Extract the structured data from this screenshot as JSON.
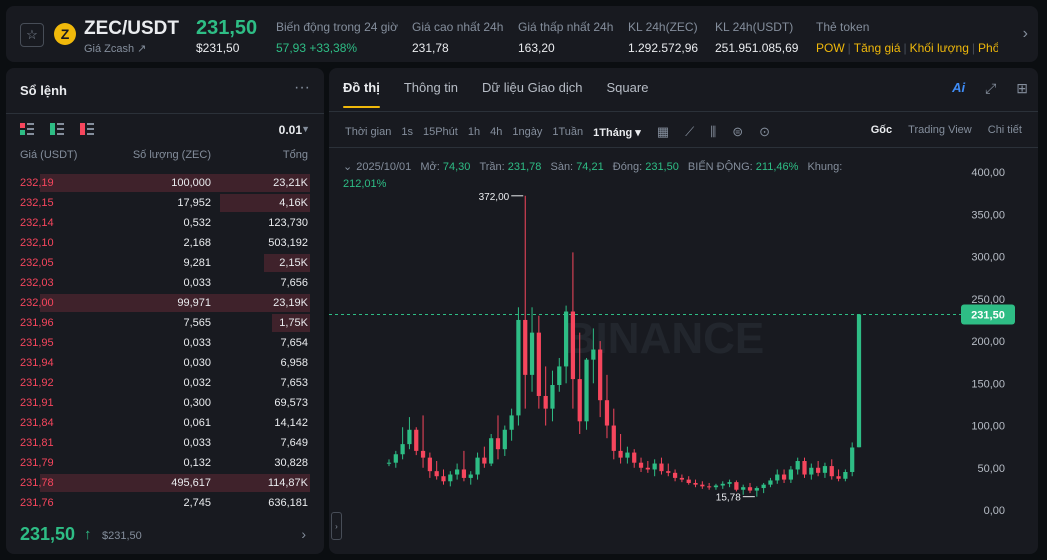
{
  "header": {
    "symbol": "ZEC/USDT",
    "coin_letter": "Z",
    "subtitle": "Giá Zcash ↗",
    "price": "231,50",
    "price_usd": "$231,50",
    "stats": [
      {
        "label": "Biến động trong 24 giờ",
        "value": "57,93 +33,38%",
        "positive": true
      },
      {
        "label": "Giá cao nhất 24h",
        "value": "231,78"
      },
      {
        "label": "Giá thấp nhất 24h",
        "value": "163,20"
      },
      {
        "label": "KL 24h(ZEC)",
        "value": "1.292.572,96"
      },
      {
        "label": "KL 24h(USDT)",
        "value": "251.951.085,69"
      }
    ],
    "token_label": "Thẻ token",
    "token_tags": [
      "POW",
      "Tăng giá",
      "Khối lượng",
      "Phổ"
    ]
  },
  "orderbook": {
    "title": "Sổ lệnh",
    "tick": "0.01",
    "col_price": "Giá (USDT)",
    "col_qty": "Số lượng (ZEC)",
    "col_total": "Tổng",
    "asks": [
      {
        "price": "232,19",
        "qty": "100,000",
        "total": "23,21K",
        "depth": 0.93
      },
      {
        "price": "232,15",
        "qty": "17,952",
        "total": "4,16K",
        "depth": 0.31
      },
      {
        "price": "232,14",
        "qty": "0,532",
        "total": "123,730",
        "depth": 0.0
      },
      {
        "price": "232,10",
        "qty": "2,168",
        "total": "503,192",
        "depth": 0.0
      },
      {
        "price": "232,05",
        "qty": "9,281",
        "total": "2,15K",
        "depth": 0.16
      },
      {
        "price": "232,03",
        "qty": "0,033",
        "total": "7,656",
        "depth": 0.0
      },
      {
        "price": "232,00",
        "qty": "99,971",
        "total": "23,19K",
        "depth": 0.93
      },
      {
        "price": "231,96",
        "qty": "7,565",
        "total": "1,75K",
        "depth": 0.13
      },
      {
        "price": "231,95",
        "qty": "0,033",
        "total": "7,654",
        "depth": 0.0
      },
      {
        "price": "231,94",
        "qty": "0,030",
        "total": "6,958",
        "depth": 0.0
      },
      {
        "price": "231,92",
        "qty": "0,032",
        "total": "7,653",
        "depth": 0.0
      },
      {
        "price": "231,91",
        "qty": "0,300",
        "total": "69,573",
        "depth": 0.0
      },
      {
        "price": "231,84",
        "qty": "0,061",
        "total": "14,142",
        "depth": 0.0
      },
      {
        "price": "231,81",
        "qty": "0,033",
        "total": "7,649",
        "depth": 0.0
      },
      {
        "price": "231,79",
        "qty": "0,132",
        "total": "30,828",
        "depth": 0.0
      },
      {
        "price": "231,78",
        "qty": "495,617",
        "total": "114,87K",
        "depth": 0.93
      },
      {
        "price": "231,76",
        "qty": "2,745",
        "total": "636,181",
        "depth": 0.0
      }
    ],
    "last_price": "231,50",
    "last_arrow": "↑",
    "last_usd": "$231,50"
  },
  "chart_panel": {
    "tabs": [
      "Đồ thị",
      "Thông tin",
      "Dữ liệu Giao dịch",
      "Square"
    ],
    "active_tab": "Đồ thị",
    "ai_label": "Ai",
    "timeframe_label": "Thời gian",
    "timeframes": [
      "1s",
      "15Phút",
      "1h",
      "4h",
      "1ngày",
      "1Tuần",
      "1Tháng ▾"
    ],
    "selected_timeframe": "1Tháng ▾",
    "views": [
      "Gốc",
      "Trading View",
      "Chi tiết"
    ],
    "selected_view": "Gốc",
    "ohlc": {
      "date": "2025/10/01",
      "open_label": "Mở:",
      "open": "74,30",
      "high_label": "Trần:",
      "high": "231,78",
      "low_label": "Sàn:",
      "low": "74,21",
      "close_label": "Đóng:",
      "close": "231,50",
      "change_label": "BIẾN ĐỘNG:",
      "change": "211,46%",
      "range_label": "Khung:",
      "range": "212,01%"
    },
    "watermark": "BINANCE",
    "current_price_label": "231,50",
    "colors": {
      "up": "#2ebd85",
      "down": "#f6465d",
      "accent": "#f0b90b"
    }
  },
  "chart_data": {
    "type": "candlestick",
    "ylim": [
      0,
      420
    ],
    "yticks": [
      0,
      50,
      100,
      150,
      200,
      250,
      300,
      350,
      400
    ],
    "ytick_labels": [
      "0,00",
      "50,00",
      "100,00",
      "150,00",
      "200,00",
      "250,00",
      "300,00",
      "350,00",
      "400,00"
    ],
    "current_price": 231.5,
    "annotations": [
      {
        "label": "372,00",
        "value": 372.0
      },
      {
        "label": "15,78",
        "value": 15.78
      }
    ],
    "candles": [
      [
        55,
        60,
        52,
        56
      ],
      [
        56,
        70,
        50,
        66
      ],
      [
        66,
        98,
        60,
        78
      ],
      [
        78,
        110,
        72,
        95
      ],
      [
        95,
        98,
        65,
        70
      ],
      [
        70,
        112,
        50,
        62
      ],
      [
        62,
        68,
        38,
        46
      ],
      [
        46,
        58,
        36,
        40
      ],
      [
        40,
        48,
        30,
        34
      ],
      [
        34,
        46,
        28,
        42
      ],
      [
        42,
        55,
        36,
        48
      ],
      [
        48,
        70,
        34,
        38
      ],
      [
        38,
        46,
        30,
        42
      ],
      [
        42,
        68,
        36,
        62
      ],
      [
        62,
        75,
        50,
        55
      ],
      [
        55,
        90,
        52,
        85
      ],
      [
        85,
        112,
        60,
        72
      ],
      [
        72,
        100,
        64,
        95
      ],
      [
        95,
        120,
        82,
        112
      ],
      [
        112,
        240,
        100,
        225
      ],
      [
        225,
        372,
        120,
        160
      ],
      [
        160,
        240,
        140,
        210
      ],
      [
        210,
        230,
        120,
        135
      ],
      [
        135,
        170,
        100,
        120
      ],
      [
        120,
        165,
        105,
        148
      ],
      [
        148,
        180,
        140,
        170
      ],
      [
        170,
        242,
        150,
        235
      ],
      [
        235,
        305,
        120,
        155
      ],
      [
        155,
        210,
        90,
        105
      ],
      [
        105,
        180,
        95,
        178
      ],
      [
        178,
        215,
        150,
        190
      ],
      [
        190,
        200,
        110,
        130
      ],
      [
        130,
        160,
        85,
        100
      ],
      [
        100,
        120,
        60,
        70
      ],
      [
        70,
        90,
        55,
        62
      ],
      [
        62,
        75,
        55,
        68
      ],
      [
        68,
        72,
        50,
        56
      ],
      [
        56,
        62,
        45,
        50
      ],
      [
        50,
        58,
        44,
        48
      ],
      [
        48,
        60,
        40,
        55
      ],
      [
        55,
        62,
        42,
        46
      ],
      [
        46,
        55,
        40,
        44
      ],
      [
        44,
        48,
        34,
        38
      ],
      [
        38,
        42,
        33,
        36
      ],
      [
        36,
        40,
        30,
        32
      ],
      [
        32,
        36,
        27,
        30
      ],
      [
        30,
        34,
        25,
        28
      ],
      [
        28,
        32,
        24,
        27
      ],
      [
        27,
        31,
        24,
        29
      ],
      [
        29,
        34,
        25,
        31
      ],
      [
        31,
        36,
        27,
        33
      ],
      [
        33,
        35,
        22,
        24
      ],
      [
        24,
        30,
        18,
        27
      ],
      [
        27,
        32,
        20,
        23
      ],
      [
        23,
        28,
        15.78,
        26
      ],
      [
        26,
        32,
        20,
        30
      ],
      [
        30,
        38,
        27,
        35
      ],
      [
        35,
        48,
        31,
        42
      ],
      [
        42,
        48,
        32,
        36
      ],
      [
        36,
        52,
        32,
        48
      ],
      [
        48,
        62,
        42,
        58
      ],
      [
        58,
        62,
        38,
        42
      ],
      [
        42,
        55,
        36,
        50
      ],
      [
        50,
        58,
        40,
        44
      ],
      [
        44,
        56,
        38,
        52
      ],
      [
        52,
        60,
        36,
        40
      ],
      [
        40,
        48,
        34,
        37
      ],
      [
        37,
        48,
        34,
        45
      ],
      [
        45,
        80,
        40,
        74
      ],
      [
        74.3,
        231.78,
        74.21,
        231.5
      ]
    ]
  }
}
